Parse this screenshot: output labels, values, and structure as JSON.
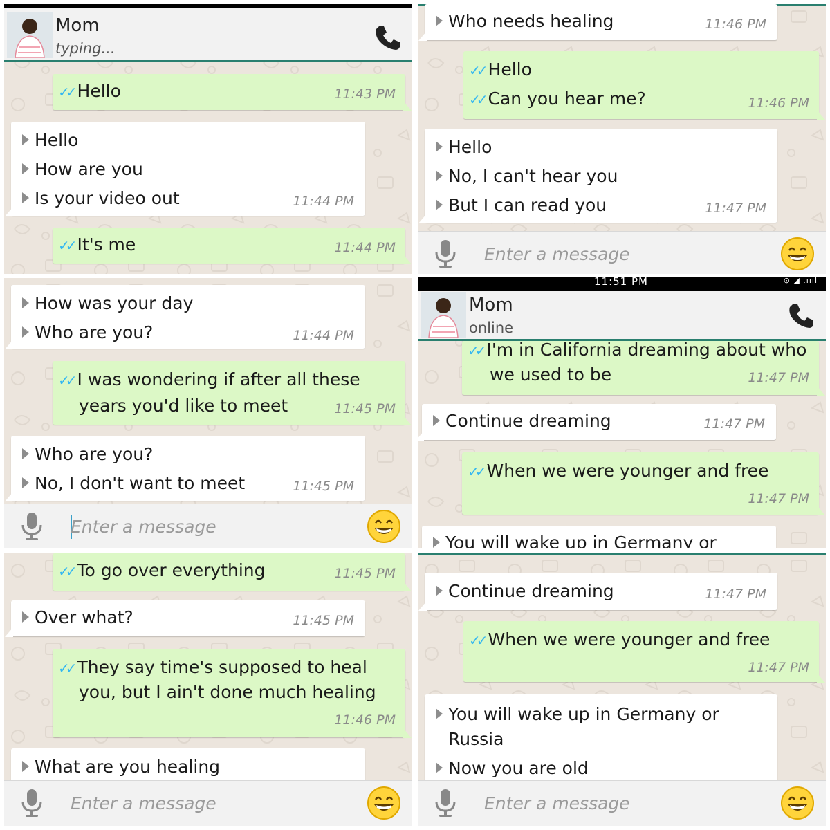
{
  "contact": {
    "name": "Mom",
    "typing": "typing...",
    "online": "online"
  },
  "input_placeholder": "Enter a message",
  "status_time": "11:51 PM",
  "status_time_top": "11:51 PM",
  "status_signal": "⊙ ◢ .ıııl",
  "colors": {
    "incoming": "#ffffff",
    "outgoing": "#dcf8c6",
    "header_accent": "#2a7f6f",
    "ticks": "#34b7f1"
  },
  "icons": [
    "mic-icon",
    "emoji-icon",
    "phone-icon",
    "double-check-icon",
    "avatar"
  ],
  "panel1": {
    "m1": {
      "lines": [
        "Hello"
      ],
      "time": "11:43 PM"
    },
    "m2": {
      "lines": [
        "Hello",
        "How are you",
        "Is your video out"
      ],
      "time": "11:44 PM"
    },
    "m3": {
      "lines": [
        "It's me"
      ],
      "time": "11:44 PM"
    }
  },
  "panel2": {
    "m1": {
      "lines": [
        "Who needs healing"
      ],
      "time": "11:46 PM"
    },
    "m2": {
      "lines": [
        "Hello",
        "Can you hear me?"
      ],
      "time": "11:46 PM"
    },
    "m3": {
      "lines": [
        "Hello",
        "No, I can't hear you",
        "But I can read you"
      ],
      "time": "11:47 PM"
    }
  },
  "panel3": {
    "m1": {
      "lines": [
        "How was your day",
        "Who are you?"
      ],
      "time": "11:44 PM"
    },
    "m2": {
      "lines": [
        "I was wondering if after all these",
        "years you'd like to meet"
      ],
      "time": "11:45 PM"
    },
    "m3": {
      "lines": [
        "Who are you?",
        "No, I don't want to meet"
      ],
      "time": "11:45 PM"
    }
  },
  "panel4": {
    "m1": {
      "lines": [
        "I'm in California dreaming about who",
        "we used to be"
      ],
      "time": "11:47 PM"
    },
    "m2": {
      "lines": [
        "Continue dreaming"
      ],
      "time": "11:47 PM"
    },
    "m3": {
      "lines": [
        "When we were younger and free"
      ],
      "time": "11:47 PM"
    },
    "m4": {
      "lines": [
        "You will wake up in Germany or"
      ]
    }
  },
  "panel5": {
    "m1": {
      "lines": [
        "To go over everything"
      ],
      "time": "11:45 PM"
    },
    "m2": {
      "lines": [
        "Over what?"
      ],
      "time": "11:45 PM"
    },
    "m3": {
      "lines": [
        "They say time's supposed to heal",
        "you, but I ain't done much healing"
      ],
      "time": "11:46 PM"
    },
    "m4": {
      "lines": [
        "What are you healing"
      ]
    }
  },
  "panel6": {
    "m1": {
      "lines": [
        "Continue dreaming"
      ],
      "time": "11:47 PM"
    },
    "m2": {
      "lines": [
        "When we were younger and free"
      ],
      "time": "11:47 PM"
    },
    "m3": {
      "lines": [
        "You will wake up in Germany or",
        "Russia",
        "Now you are old"
      ]
    }
  }
}
